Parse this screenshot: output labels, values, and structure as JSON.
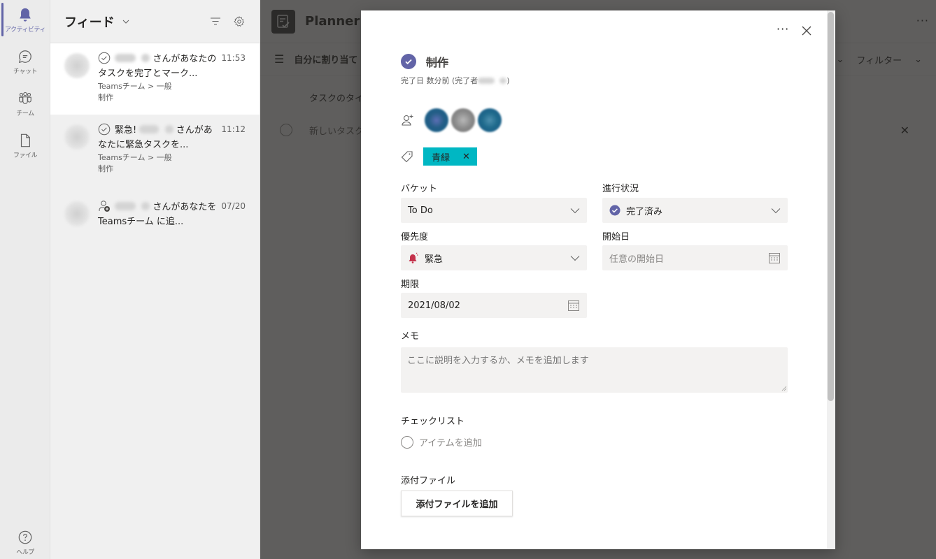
{
  "rail": {
    "items": [
      {
        "label": "アクティビティ",
        "icon": "bell-icon",
        "active": true
      },
      {
        "label": "チャット",
        "icon": "chat-icon",
        "active": false
      },
      {
        "label": "チーム",
        "icon": "teams-icon",
        "active": false
      },
      {
        "label": "ファイル",
        "icon": "file-icon",
        "active": false
      }
    ],
    "help_label": "ヘルプ"
  },
  "feed": {
    "title": "フィード",
    "items": [
      {
        "icon": "check-circle-icon",
        "text_prefix": "",
        "text_suffix": "さんがあなたのタスクを完了とマーク...",
        "time": "11:53",
        "channel": "Teamsチーム > 一般",
        "task": "制作",
        "selected": true
      },
      {
        "icon": "check-circle-icon",
        "text_prefix": "緊急!",
        "text_suffix": "さんがあなたに緊急タスクを...",
        "time": "11:12",
        "channel": "Teamsチーム > 一般",
        "task": "制作",
        "selected": false
      },
      {
        "icon": "person-add-icon",
        "text_prefix": "",
        "text_suffix": "さんがあなたを Teamsチーム に追...",
        "time": "07/20",
        "channel": "",
        "task": "",
        "selected": false
      }
    ]
  },
  "planner": {
    "title": "Planner a",
    "view_label": "自分に割り当て",
    "filter_label": "フィルター",
    "task_column": "タスクのタイト",
    "new_task": "新しいタスク"
  },
  "task": {
    "title": "制作",
    "completed_info": "完了日 数分前 (完了者",
    "completed_suffix": ")",
    "label_chip": "青緑",
    "fields": {
      "bucket_label": "バケット",
      "bucket_value": "To Do",
      "progress_label": "進行状況",
      "progress_value": "完了済み",
      "priority_label": "優先度",
      "priority_value": "緊急",
      "start_label": "開始日",
      "start_placeholder": "任意の開始日",
      "due_label": "期限",
      "due_value": "2021/08/02"
    },
    "memo_label": "メモ",
    "memo_placeholder": "ここに説明を入力するか、メモを追加します",
    "checklist_label": "チェックリスト",
    "checklist_add": "アイテムを追加",
    "attachments_label": "添付ファイル",
    "attach_button": "添付ファイルを追加"
  },
  "colors": {
    "accent": "#6264a7",
    "label_teal": "#00b7c3",
    "urgent_red": "#c4314b"
  }
}
